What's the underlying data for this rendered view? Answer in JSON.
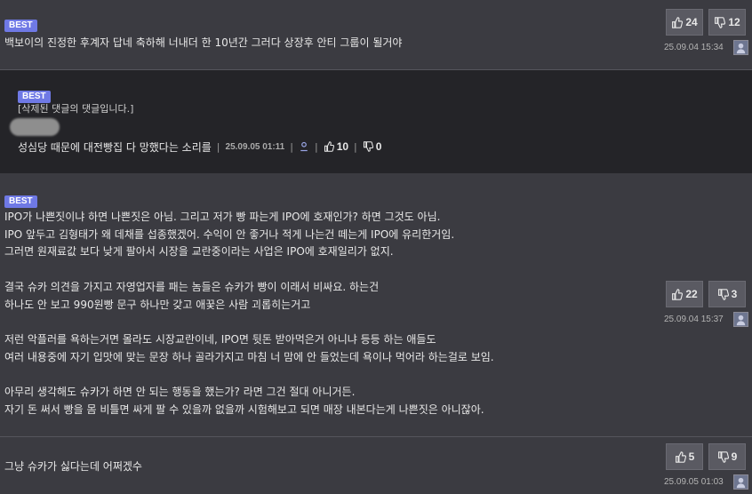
{
  "comments": [
    {
      "badge": "BEST",
      "text": "백보이의 진정한 후계자 답네 축하해 너내더 한 10년간 그러다 상장후 안티 그룹이 될거야",
      "up": "24",
      "down": "12",
      "timestamp": "25.09.04 15:34"
    },
    {
      "badge": "BEST",
      "text": "IPO가 나쁜짓이냐 하면 나쁜짓은 아님. 그리고 저가 빵 파는게 IPO에 호재인가? 하면 그것도 아님.\nIPO 앞두고 김형태가 왜 데채를 섭종했겠어. 수익이 안 좋거나 적게 나는건 떼는게 IPO에 유리한거임.\n그러면 원재료값 보다 낮게 팔아서 시장을 교란중이라는 사업은 IPO에 호재일리가 없지.\n\n결국 슈카 의견을 가지고 자영업자를 패는 놈들은 슈카가 빵이 이래서 비싸요. 하는건\n하나도 안 보고 990원빵 문구 하나만 갖고 애꿎은 사람 괴롭히는거고\n\n저런 악플러를 욕하는거면 몰라도 시장교란이네, IPO면 뒷돈 받아먹은거 아니냐 등등 하는 애들도\n여러 내용중에 자기 입맛에 맞는 문장 하나 골라가지고 마침 너 맘에 안 들었는데 욕이나 먹어라 하는걸로 보임.\n\n아무리 생각해도 슈카가 하면 안 되는 행동을 했는가? 라면 그건 절대 아니거든.\n자기 돈 써서 빵을 몸 비틀면 싸게 팔 수 있을까 없을까 시험해보고 되면 매장 내본다는게 나쁜짓은 아니잖아.",
      "up": "22",
      "down": "3",
      "timestamp": "25.09.04 15:37"
    },
    {
      "text": "그냥 슈카가 싫다는데 어쩌겠수",
      "up": "5",
      "down": "9",
      "timestamp": "25.09.05 01:03"
    }
  ],
  "reply": {
    "badge": "BEST",
    "deleted_note": "[삭제된 댓글의 댓글입니다.]",
    "text": "성심당 때문에 대전빵집 다 망했다는 소리를",
    "timestamp": "25.09.05 01:11",
    "up": "10",
    "down": "0"
  },
  "icons": {
    "upvote": "thumbs-up-icon",
    "downvote": "thumbs-down-icon",
    "avatar": "user-avatar-icon",
    "report": "person-icon"
  },
  "colors": {
    "best_badge": "#6f79e5",
    "background": "#3b3b41",
    "reply_background": "#242428"
  }
}
